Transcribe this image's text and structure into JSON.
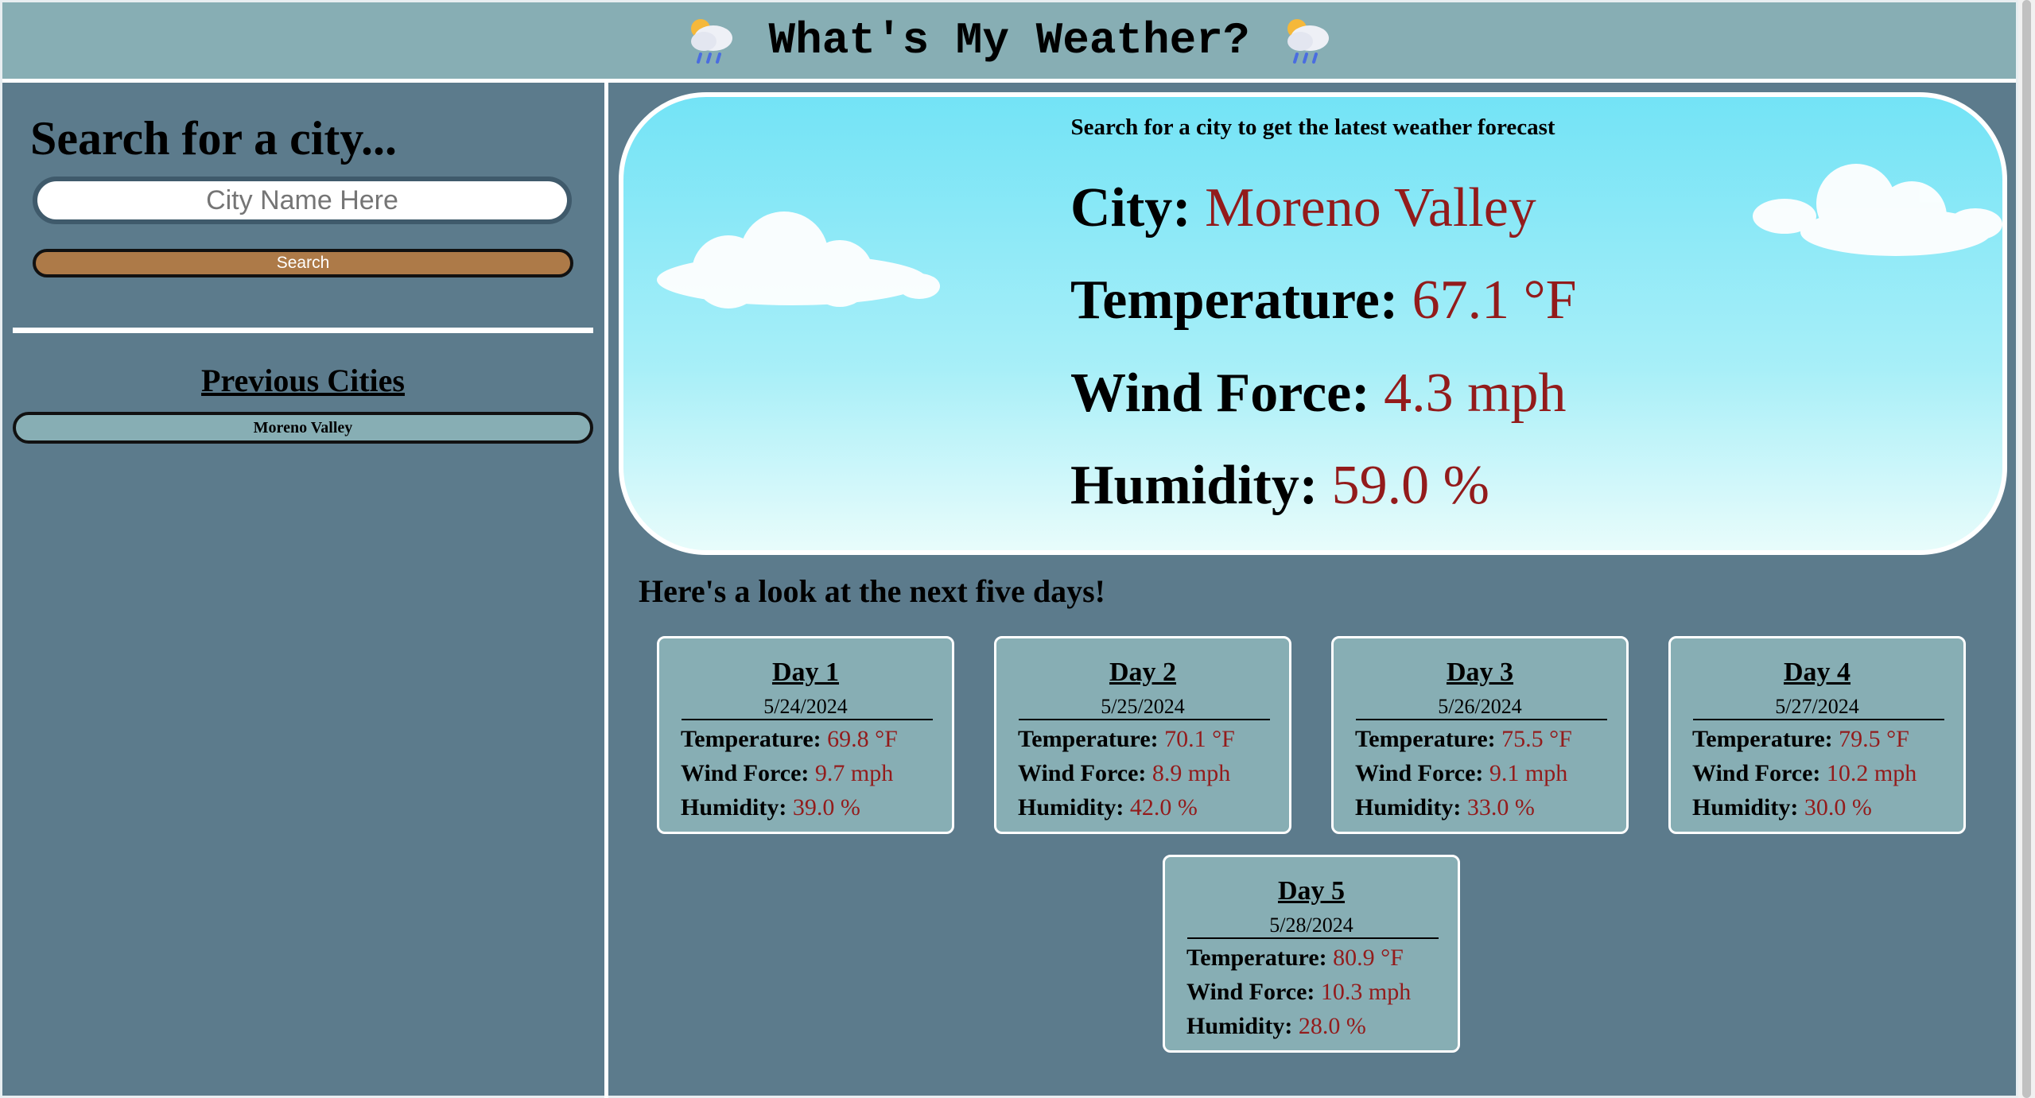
{
  "header": {
    "title": "What's My Weather?",
    "left_icon": "rain-cloud-icon",
    "right_icon": "rain-cloud-icon"
  },
  "sidebar": {
    "heading": "Search for a city...",
    "input_placeholder": "City Name Here",
    "input_value": "",
    "search_label": "Search",
    "previous_heading": "Previous Cities",
    "previous_cities": [
      "Moreno Valley"
    ]
  },
  "current": {
    "subtitle": "Search for a city to get the latest weather forecast",
    "city_label": "City:",
    "city": "Moreno Valley",
    "temp_label": "Temperature:",
    "temp": "67.1 °F",
    "wind_label": "Wind Force:",
    "wind": "4.3 mph",
    "humidity_label": "Humidity:",
    "humidity": "59.0 %"
  },
  "forecast": {
    "title": "Here's a look at the next five days!",
    "temp_label": "Temperature:",
    "wind_label": "Wind Force:",
    "humidity_label": "Humidity:",
    "days": [
      {
        "title": "Day 1",
        "date": "5/24/2024",
        "temp": "69.8 °F",
        "wind": "9.7 mph",
        "humidity": "39.0 %"
      },
      {
        "title": "Day 2",
        "date": "5/25/2024",
        "temp": "70.1 °F",
        "wind": "8.9 mph",
        "humidity": "42.0 %"
      },
      {
        "title": "Day 3",
        "date": "5/26/2024",
        "temp": "75.5 °F",
        "wind": "9.1 mph",
        "humidity": "33.0 %"
      },
      {
        "title": "Day 4",
        "date": "5/27/2024",
        "temp": "79.5 °F",
        "wind": "10.2 mph",
        "humidity": "30.0 %"
      },
      {
        "title": "Day 5",
        "date": "5/28/2024",
        "temp": "80.9 °F",
        "wind": "10.3 mph",
        "humidity": "28.0 %"
      }
    ]
  },
  "colors": {
    "header_bg": "#87aeb4",
    "page_bg": "#5c7b8c",
    "value_red": "#931b1b",
    "button_bg": "#ad7a48"
  }
}
